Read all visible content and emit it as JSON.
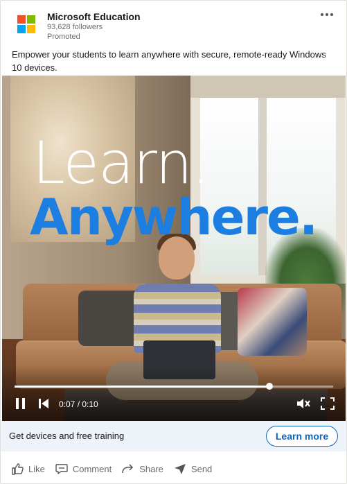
{
  "header": {
    "company_name": "Microsoft Education",
    "followers": "93,628 followers",
    "promoted": "Promoted",
    "logo_colors": [
      "#f25022",
      "#7fba00",
      "#00a4ef",
      "#ffb900"
    ]
  },
  "post": {
    "text": "Empower your students to learn anywhere with secure, remote-ready Windows 10 devices."
  },
  "video": {
    "headline_line1": "Learn.",
    "headline_line2": "Anywhere.",
    "time": "0:07 / 0:10",
    "progress": 0.8
  },
  "cta": {
    "text": "Get devices and free training",
    "button_label": "Learn more"
  },
  "actions": [
    {
      "label": "Like",
      "icon": "like-icon"
    },
    {
      "label": "Comment",
      "icon": "comment-icon"
    },
    {
      "label": "Share",
      "icon": "share-icon"
    },
    {
      "label": "Send",
      "icon": "send-icon"
    }
  ],
  "colors": {
    "accent": "#0a66c2",
    "headline_blue": "#1b7ee0",
    "cta_background": "#edf3f8"
  }
}
